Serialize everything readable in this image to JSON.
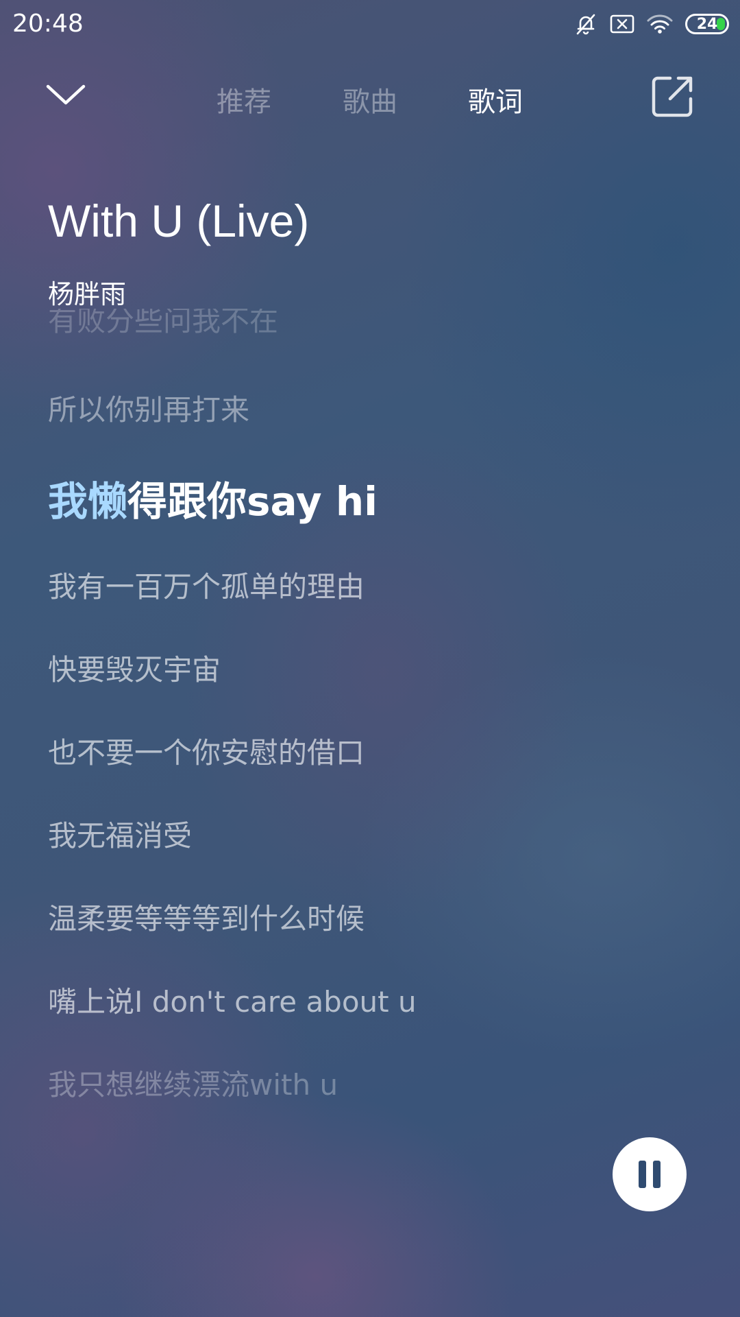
{
  "status_bar": {
    "time": "20:48",
    "battery_level": "24",
    "icons": [
      "bell-off-icon",
      "sim-error-icon",
      "wifi-icon",
      "battery-icon"
    ]
  },
  "nav": {
    "tabs": [
      {
        "label": "推荐",
        "active": false
      },
      {
        "label": "歌曲",
        "active": false
      },
      {
        "label": "歌词",
        "active": true
      }
    ],
    "icons": [
      "chevron-down-icon",
      "share-icon"
    ]
  },
  "song": {
    "title": "With U (Live)",
    "artist": "杨胖雨"
  },
  "lyrics": {
    "partial_top": "有败分些问我不在",
    "before_current": "所以你别再打来",
    "current_sung": "我懒",
    "current_unsung": "得跟你say hi",
    "after": [
      "我有一百万个孤单的理由",
      "快要毁灭宇宙",
      "也不要一个你安慰的借口",
      "我无福消受",
      "温柔要等等等到什么时候",
      "嘴上说I don't care about u",
      "我只想继续漂流with u"
    ]
  },
  "controls": {
    "pause_icon": "pause-icon",
    "accent_color": "#a9d9ff"
  }
}
